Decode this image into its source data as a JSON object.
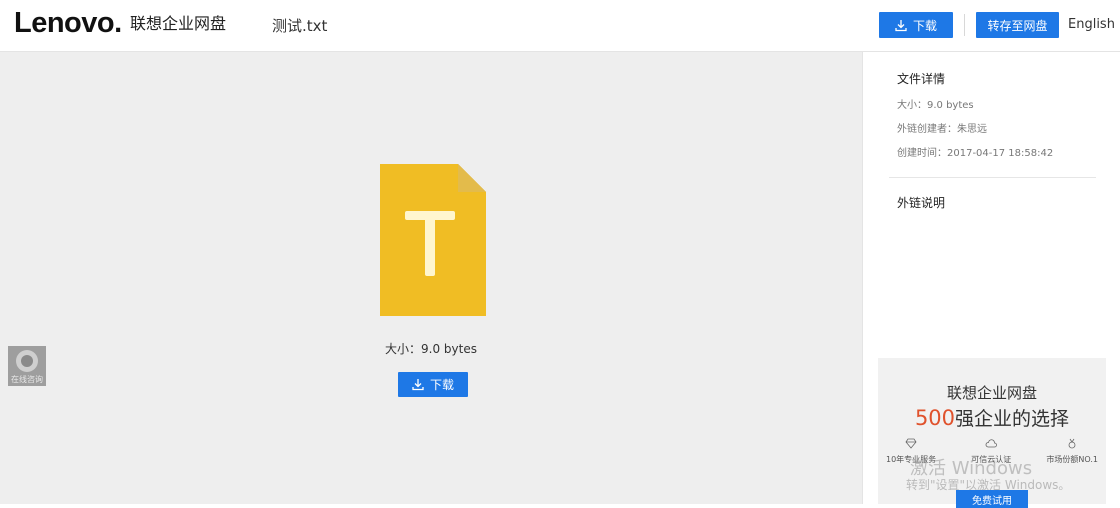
{
  "header": {
    "logo": "Lenovo",
    "logo_dot": ".",
    "product": "联想企业网盘",
    "filename": "测试.txt",
    "download_label": "下载",
    "save_label": "转存至网盘",
    "language_label": "English"
  },
  "main": {
    "file_icon_letter": "T",
    "size_text": "大小：9.0 bytes",
    "download_label": "下载",
    "support_label": "在线咨询"
  },
  "sidebar": {
    "details_title": "文件详情",
    "size_text": "大小：9.0 bytes",
    "creator_text": "外链创建者：朱思远",
    "created_text": "创建时间：2017-04-17 18:58:42",
    "link_desc_title": "外链说明"
  },
  "ad": {
    "title": "联想企业网盘",
    "slogan_num": "500",
    "slogan_rest": "强企业的选择",
    "features": [
      "10年专业服务",
      "可信云认证",
      "市场份额NO.1"
    ],
    "trial_label": "免费试用"
  },
  "watermark": {
    "line1": "激活 Windows",
    "line2": "转到\"设置\"以激活 Windows。"
  },
  "colors": {
    "accent": "#1e78e6",
    "file_icon": "#f0bd24",
    "highlight": "#e0522c"
  }
}
